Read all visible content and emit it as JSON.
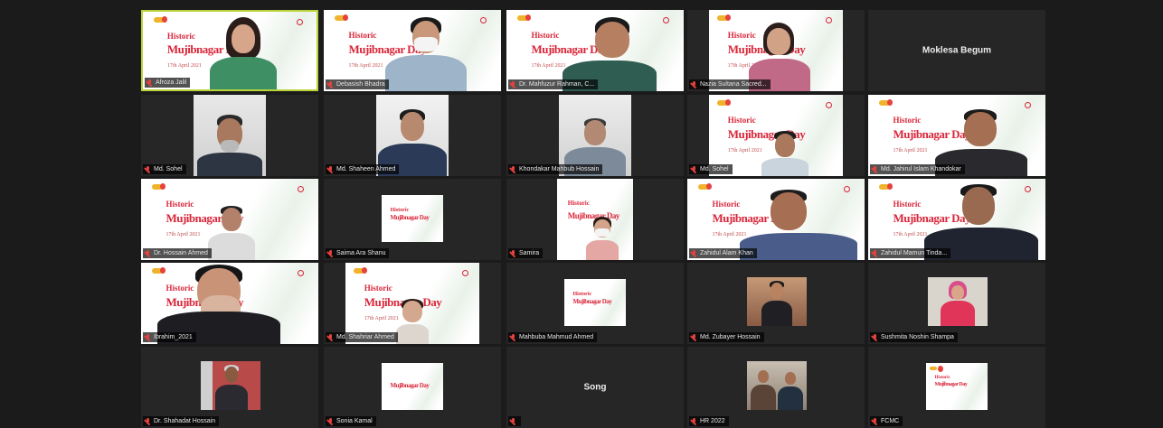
{
  "tiles": [
    {
      "name": "Afroza Jalil"
    },
    {
      "name": "Debasish Bhadra"
    },
    {
      "name": "Dr. Mahfuzur Rahman, C..."
    },
    {
      "name": "Nazia Sultana Sacred..."
    },
    {
      "name": "Moklesa Begum"
    },
    {
      "name": "Md. Sohel"
    },
    {
      "name": "Md. Shaheen Ahmed"
    },
    {
      "name": "Khondakar Mahbub Hossain"
    },
    {
      "name": "Md. Sohel"
    },
    {
      "name": "Md. Jahirul Islam Khandokar"
    },
    {
      "name": "Dr. Hossain Ahmed"
    },
    {
      "name": "Saima Ara Shanu"
    },
    {
      "name": "Samira"
    },
    {
      "name": "Zahidul Alam Khan"
    },
    {
      "name": "Zahidul Mamun Tinda..."
    },
    {
      "name": "Ibrahim_2021"
    },
    {
      "name": "Md. Shahriar Ahmed"
    },
    {
      "name": "Mahbuba Mahmud Ahmed"
    },
    {
      "name": "Md. Zubayer Hossain"
    },
    {
      "name": "Sushmita Noshin Shampa"
    },
    {
      "name": "Dr. Shahadat Hossain"
    },
    {
      "name": "Sonia Kamal"
    },
    {
      "name": "Song"
    },
    {
      "name": "HR 2022"
    },
    {
      "name": "FCMC"
    }
  ],
  "slide": {
    "line1": "Historic",
    "line2": "Mujibnagar Day",
    "line3": "17th April 2021"
  },
  "colors": {
    "active_speaker": "#b8d43a",
    "muted_mic": "#e5423d",
    "slide_title": "#d9263a",
    "tile_bg": "#262626"
  }
}
